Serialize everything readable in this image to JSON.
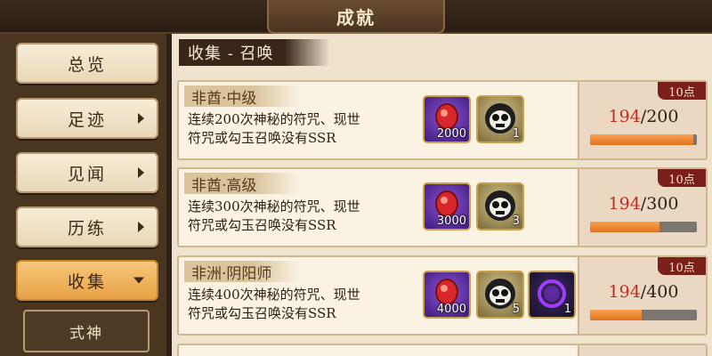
{
  "header": {
    "title": "成就"
  },
  "sidebar": {
    "items": [
      {
        "label": "总览",
        "arrow": false
      },
      {
        "label": "足迹",
        "arrow": true
      },
      {
        "label": "见闻",
        "arrow": true
      },
      {
        "label": "历练",
        "arrow": true
      },
      {
        "label": "收集",
        "arrow": true,
        "active": true
      }
    ],
    "sub_item": "式神"
  },
  "main": {
    "section_title": "收集 - 召唤",
    "achievements": [
      {
        "name": "非酋·中级",
        "desc_line1": "连续200次神秘的符咒、现世",
        "desc_line2": "符咒或勾玉召唤没有SSR",
        "rewards": [
          {
            "icon": "jade-icon",
            "count": "2000"
          },
          {
            "icon": "daruma-icon",
            "count": "1"
          }
        ],
        "points": "10点",
        "current": "194",
        "total": "/200",
        "progress": 0.97
      },
      {
        "name": "非酋·高级",
        "desc_line1": "连续300次神秘的符咒、现世",
        "desc_line2": "符咒或勾玉召唤没有SSR",
        "rewards": [
          {
            "icon": "jade-icon",
            "count": "3000"
          },
          {
            "icon": "daruma-icon",
            "count": "3"
          }
        ],
        "points": "10点",
        "current": "194",
        "total": "/300",
        "progress": 0.647
      },
      {
        "name": "非洲·阴阳师",
        "desc_line1": "连续400次神秘的符咒、现世",
        "desc_line2": "符咒或勾玉召唤没有SSR",
        "rewards": [
          {
            "icon": "jade-icon",
            "count": "4000"
          },
          {
            "icon": "daruma-icon",
            "count": "5"
          },
          {
            "icon": "ring-icon",
            "count": "1"
          }
        ],
        "points": "10点",
        "current": "194",
        "total": "/400",
        "progress": 0.485
      }
    ]
  },
  "colors": {
    "accent": "#e2721e",
    "current_value": "#c12d20",
    "points_badge": "#7a1f1a"
  }
}
